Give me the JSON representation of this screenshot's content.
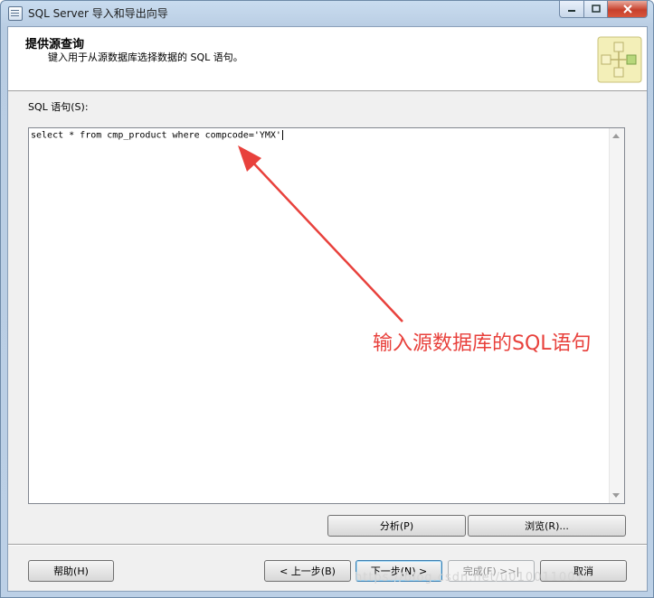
{
  "window": {
    "title": "SQL Server 导入和导出向导"
  },
  "header": {
    "title": "提供源查询",
    "subtitle": "键入用于从源数据库选择数据的 SQL 语句。"
  },
  "sql": {
    "label": "SQL 语句(S):",
    "query": "select * from cmp_product where compcode='YMX'"
  },
  "buttons": {
    "parse": "分析(P)",
    "browse": "浏览(R)...",
    "help": "帮助(H)",
    "back": "< 上一步(B)",
    "next": "下一步(N) >",
    "finish": "完成(F) >>|",
    "cancel": "取消"
  },
  "annotation": {
    "text": "输入源数据库的SQL语句",
    "color": "#e8413c"
  },
  "watermark": "https://blog.csdn.net/u010011001",
  "icons": [
    "app-icon",
    "minimize-icon",
    "maximize-icon",
    "close-icon",
    "wizard-icon",
    "scroll-up-icon",
    "scroll-down-icon",
    "arrow-annotation"
  ]
}
